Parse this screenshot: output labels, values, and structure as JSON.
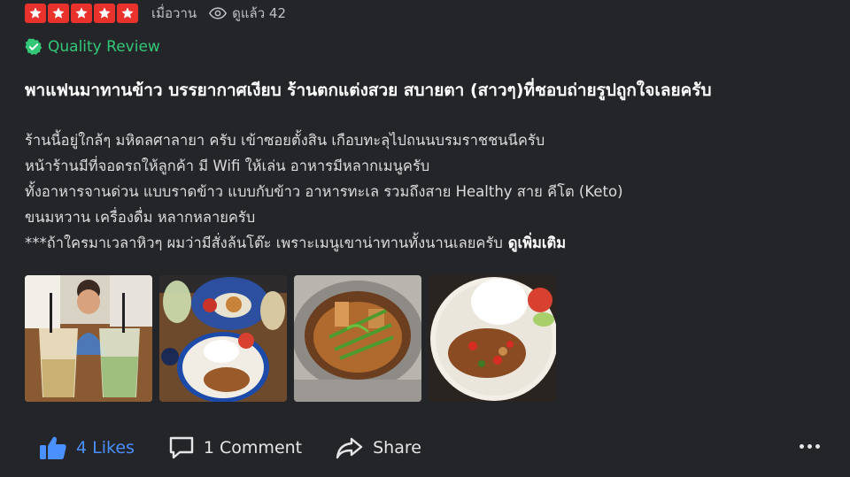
{
  "review": {
    "rating": 5,
    "time_ago": "เมื่อวาน",
    "views_label": "ดูแล้ว 42",
    "quality_label": "Quality Review",
    "title": "พาแฟนมาทานข้าว บรรยากาศเงียบ ร้านตกแต่งสวย สบายตา (สาวๆ)ที่ชอบถ่ายรูปถูกใจเลยครับ",
    "body_lines": [
      "ร้านนี้อยู่ใกล้ๆ มหิดลศาลายา ครับ เข้าซอยตั้งสิน เกือบทะลุไปถนนบรมราชชนนีครับ",
      "หน้าร้านมีที่จอดรถให้ลูกค้า มี Wifi ให้เล่น อาหารมีหลากเมนูครับ",
      "ทั้งอาหารจานด่วน แบบราดข้าว แบบกับข้าว อาหารทะเล รวมถึงสาย Healthy สาย คีโต (Keto)",
      "ขนมหวาน เครื่องดื่ม หลากหลายครับ",
      "***ถ้าใครมาเวลาหิวๆ ผมว่ามีสั่งล้นโต๊ะ เพราะเมนูเขาน่าทานทั้งนานเลยครับ"
    ],
    "read_more": "ดูเพิ่มเติม"
  },
  "actions": {
    "likes": "4 Likes",
    "comment": "1 Comment",
    "share": "Share"
  },
  "icons": {
    "star": "star-icon",
    "eye": "eye-icon",
    "quality": "check-badge-icon",
    "like": "thumbs-up-icon",
    "comment": "comment-icon",
    "share": "share-arrow-icon",
    "more": "more-dots-icon"
  },
  "colors": {
    "star_bg": "#e8322b",
    "quality_green": "#33c878",
    "like_blue": "#4a90ff",
    "background": "#242528"
  }
}
